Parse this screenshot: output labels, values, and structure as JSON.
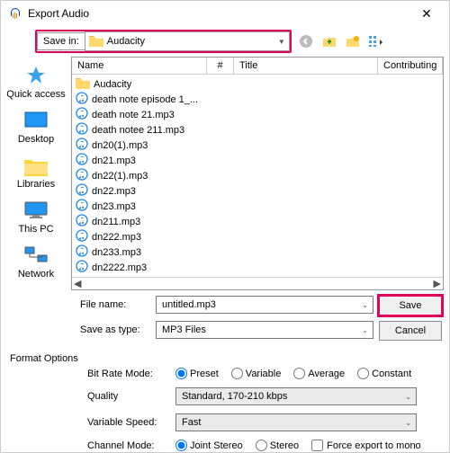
{
  "window": {
    "title": "Export Audio"
  },
  "savein": {
    "label": "Save in:",
    "value": "Audacity"
  },
  "places": {
    "quick": "Quick access",
    "desktop": "Desktop",
    "libraries": "Libraries",
    "thispc": "This PC",
    "network": "Network"
  },
  "columns": {
    "name": "Name",
    "hash": "#",
    "title": "Title",
    "contrib": "Contributing"
  },
  "files": [
    {
      "type": "folder",
      "name": "Audacity"
    },
    {
      "type": "audio",
      "name": "death note episode 1_..."
    },
    {
      "type": "audio",
      "name": "death note 21.mp3"
    },
    {
      "type": "audio",
      "name": "death notee 211.mp3"
    },
    {
      "type": "audio",
      "name": "dn20(1).mp3"
    },
    {
      "type": "audio",
      "name": "dn21.mp3"
    },
    {
      "type": "audio",
      "name": "dn22(1).mp3"
    },
    {
      "type": "audio",
      "name": "dn22.mp3"
    },
    {
      "type": "audio",
      "name": "dn23.mp3"
    },
    {
      "type": "audio",
      "name": "dn211.mp3"
    },
    {
      "type": "audio",
      "name": "dn222.mp3"
    },
    {
      "type": "audio",
      "name": "dn233.mp3"
    },
    {
      "type": "audio",
      "name": "dn2222.mp3"
    }
  ],
  "form": {
    "filename_label": "File name:",
    "filename_value": "untitled.mp3",
    "type_label": "Save as type:",
    "type_value": "MP3 Files",
    "save": "Save",
    "cancel": "Cancel"
  },
  "options_title": "Format Options",
  "options": {
    "bitrate_label": "Bit Rate Mode:",
    "bitrate": {
      "preset": "Preset",
      "variable": "Variable",
      "average": "Average",
      "constant": "Constant"
    },
    "quality_label": "Quality",
    "quality_value": "Standard, 170-210 kbps",
    "speed_label": "Variable Speed:",
    "speed_value": "Fast",
    "channel_label": "Channel Mode:",
    "channel": {
      "joint": "Joint Stereo",
      "stereo": "Stereo"
    },
    "force_mono": "Force export to mono"
  }
}
